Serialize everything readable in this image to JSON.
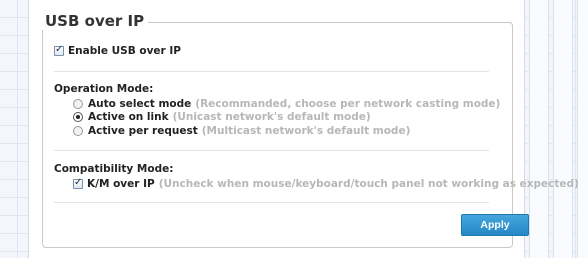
{
  "section": {
    "title": "USB over IP"
  },
  "enable": {
    "label": "Enable USB over IP",
    "checked": true
  },
  "operation_mode": {
    "heading": "Operation Mode:",
    "options": [
      {
        "label": "Auto select mode",
        "hint": "(Recommanded, choose per network casting mode)",
        "selected": false
      },
      {
        "label": "Active on link",
        "hint": "(Unicast network's default mode)",
        "selected": true
      },
      {
        "label": "Active per request",
        "hint": "(Multicast network's default mode)",
        "selected": false
      }
    ]
  },
  "compatibility_mode": {
    "heading": "Compatibility Mode:",
    "km_label": "K/M over IP",
    "km_hint": "(Uncheck when mouse/keyboard/touch panel not working as expected)",
    "km_checked": true
  },
  "apply_button": {
    "label": "Apply"
  },
  "colors": {
    "accent": "#2a8ccc",
    "hint_text": "#b7b7b7"
  }
}
